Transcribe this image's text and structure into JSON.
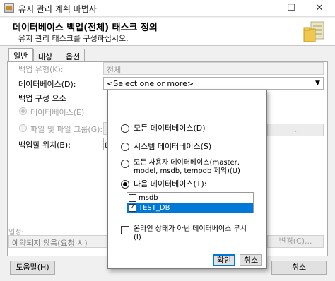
{
  "window": {
    "title": "유지 관리 계획 마법사",
    "minimize": "—",
    "maximize": "☐",
    "close": "✕"
  },
  "header": {
    "title": "데이터베이스 백업(전체) 태스크 정의",
    "subtitle": "유지 관리 태스크를 구성하십시오."
  },
  "tabs": [
    "일반",
    "대상",
    "옵션"
  ],
  "form": {
    "backup_type_label": "백업 유형(K):",
    "backup_type_value": "전체",
    "databases_label": "데이터베이스(D):",
    "databases_value": "<Select one or more>",
    "backup_component_label": "백업 구성 요소",
    "radio_database": "데이터베이스(E)",
    "radio_files": "파일 및 파일 그룹(G):",
    "browse_label": "...",
    "backup_to_label": "백업할 위치(B):",
    "backup_to_value": "디",
    "schedule_label": "일정:",
    "schedule_value": "예약되지 않음(요청 시)",
    "change_label": "변경(C)..."
  },
  "popup": {
    "all_databases": "모든 데이터베이스(D)",
    "system_databases": "시스템 데이터베이스(S)",
    "all_user_databases_line1": "모든 사용자 데이터베이스(master,",
    "all_user_databases_line2": "model, msdb, tempdb 제외)(U)",
    "these_databases": "다음 데이터베이스(T):",
    "db_list": [
      {
        "name": "msdb",
        "checked": false,
        "checkmark": ""
      },
      {
        "name": "TEST_DB",
        "checked": true,
        "checkmark": "✓"
      }
    ],
    "ignore_offline_line1": "온라인 상태가 아닌 데이터베이스 무시",
    "ignore_offline_line2": "(I)",
    "ok": "확인",
    "cancel": "취소"
  },
  "footer": {
    "help": "도움말(H)",
    "cancel": "취소"
  },
  "colors": {
    "accent": "#0078d7",
    "selection": "#0078d7",
    "window_bg": "#f0f0f0"
  },
  "icons": {
    "wizard_art": "folders-wizard-icon",
    "app": "wizard-app-icon",
    "dropdown": "chevron-down-icon"
  }
}
